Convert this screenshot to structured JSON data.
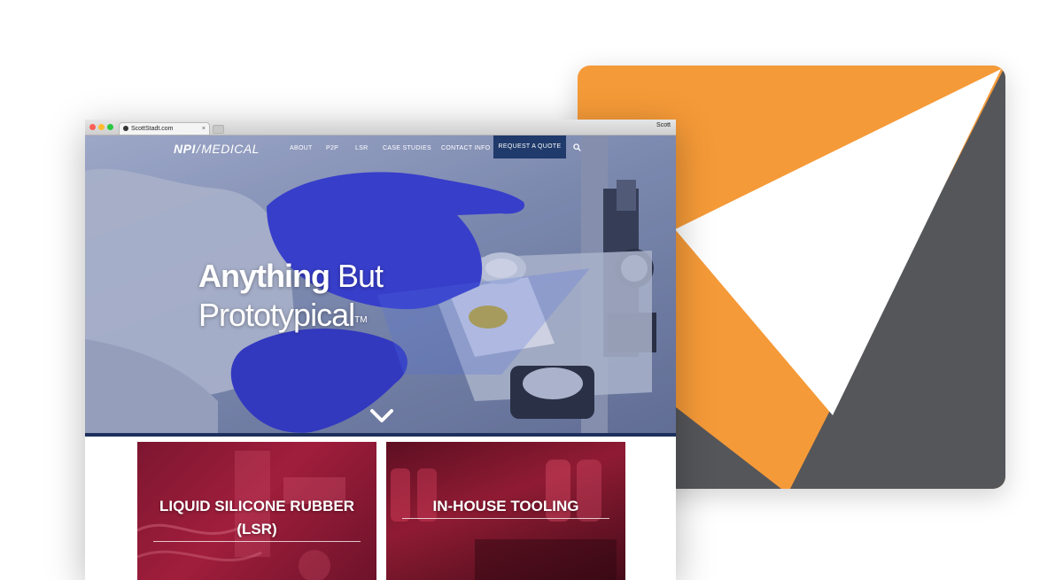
{
  "browser": {
    "tab_title": "ScottStadt.com",
    "tab_close": "×",
    "profile_name": "Scott"
  },
  "site": {
    "brand_npi": "NPI",
    "brand_separator": "/",
    "brand_medical": "MEDICAL",
    "nav": [
      "ABOUT",
      "P2P",
      "LSR",
      "CASE STUDIES",
      "CONTACT INFO"
    ],
    "cta": "REQUEST A QUOTE",
    "search_icon": "search-icon"
  },
  "hero": {
    "headline_strong": "Anything",
    "headline_light": "But",
    "headline_line2": "Prototypical",
    "trademark": "TM",
    "scroll_icon": "chevron-down-icon"
  },
  "cards": [
    {
      "title": "LIQUID SILICONE RUBBER (LSR)"
    },
    {
      "title": "IN-HOUSE TOOLING"
    }
  ],
  "colors": {
    "logo_orange": "#f59a38",
    "logo_gray": "#55565a",
    "nav_cta": "#1f3a6b",
    "card_red": "#a01e3c"
  }
}
